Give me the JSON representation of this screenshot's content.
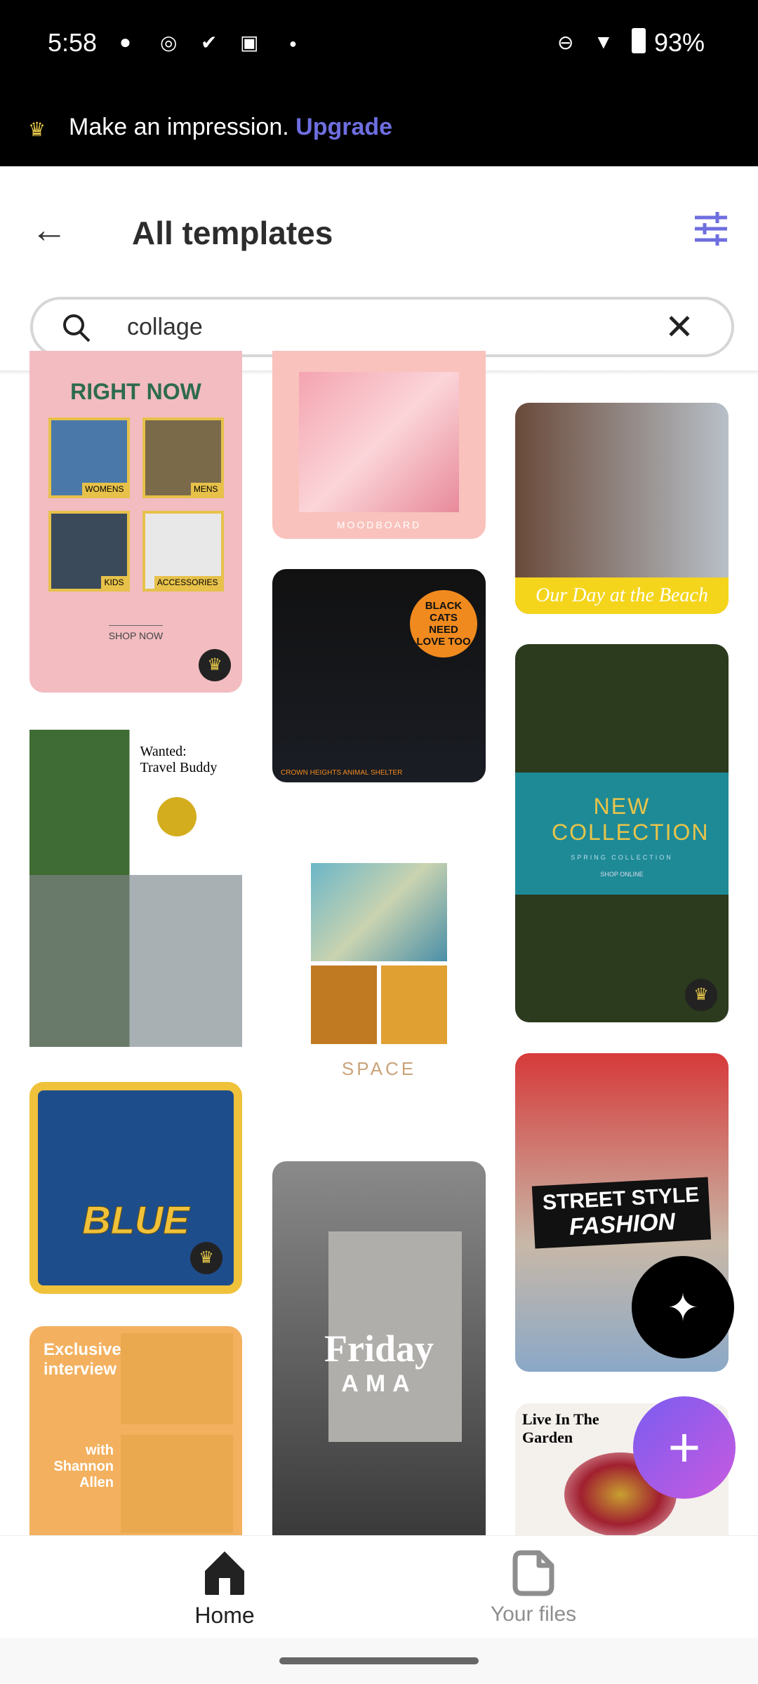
{
  "status_bar": {
    "time": "5:58",
    "battery": "93%",
    "icons": [
      "chat-bubble-icon",
      "sync-icon",
      "check-icon",
      "outlook-icon",
      "dot-icon",
      "dnd-icon",
      "wifi-icon",
      "battery-icon"
    ]
  },
  "banner": {
    "text": "Make an impression.",
    "link": "Upgrade",
    "accent": "#6e6ee0"
  },
  "header": {
    "title": "All templates"
  },
  "search": {
    "value": "collage"
  },
  "templates": {
    "c1": {
      "title": "RIGHT NOW",
      "labels": [
        "WOMENS",
        "MENS",
        "KIDS",
        "ACCESSORIES"
      ],
      "cta": "SHOP NOW"
    },
    "c2": {
      "title": "Wanted:",
      "subtitle": "Travel Buddy"
    },
    "c3": {
      "title": "BLUE"
    },
    "c4": {
      "title": "Exclusive interview",
      "by": "with Shannon Allen"
    },
    "c5": {
      "title": "MOODBOARD"
    },
    "c6": {
      "title": "BLACK CATS NEED LOVE TOO",
      "footer": "CROWN HEIGHTS ANIMAL SHELTER"
    },
    "c7": {
      "title": "SPACE"
    },
    "c8": {
      "title": "Friday",
      "subtitle": "AMA"
    },
    "c9": {
      "title": "Our Day at the Beach"
    },
    "c10": {
      "title": "NEW COLLECTION",
      "subtitle": "SPRING COLLECTION",
      "cta": "SHOP ONLINE"
    },
    "c11": {
      "title": "STREET STYLE",
      "subtitle": "FASHION"
    },
    "c12": {
      "title": "Live In The Garden"
    }
  },
  "nav": {
    "home": "Home",
    "files": "Your files"
  }
}
